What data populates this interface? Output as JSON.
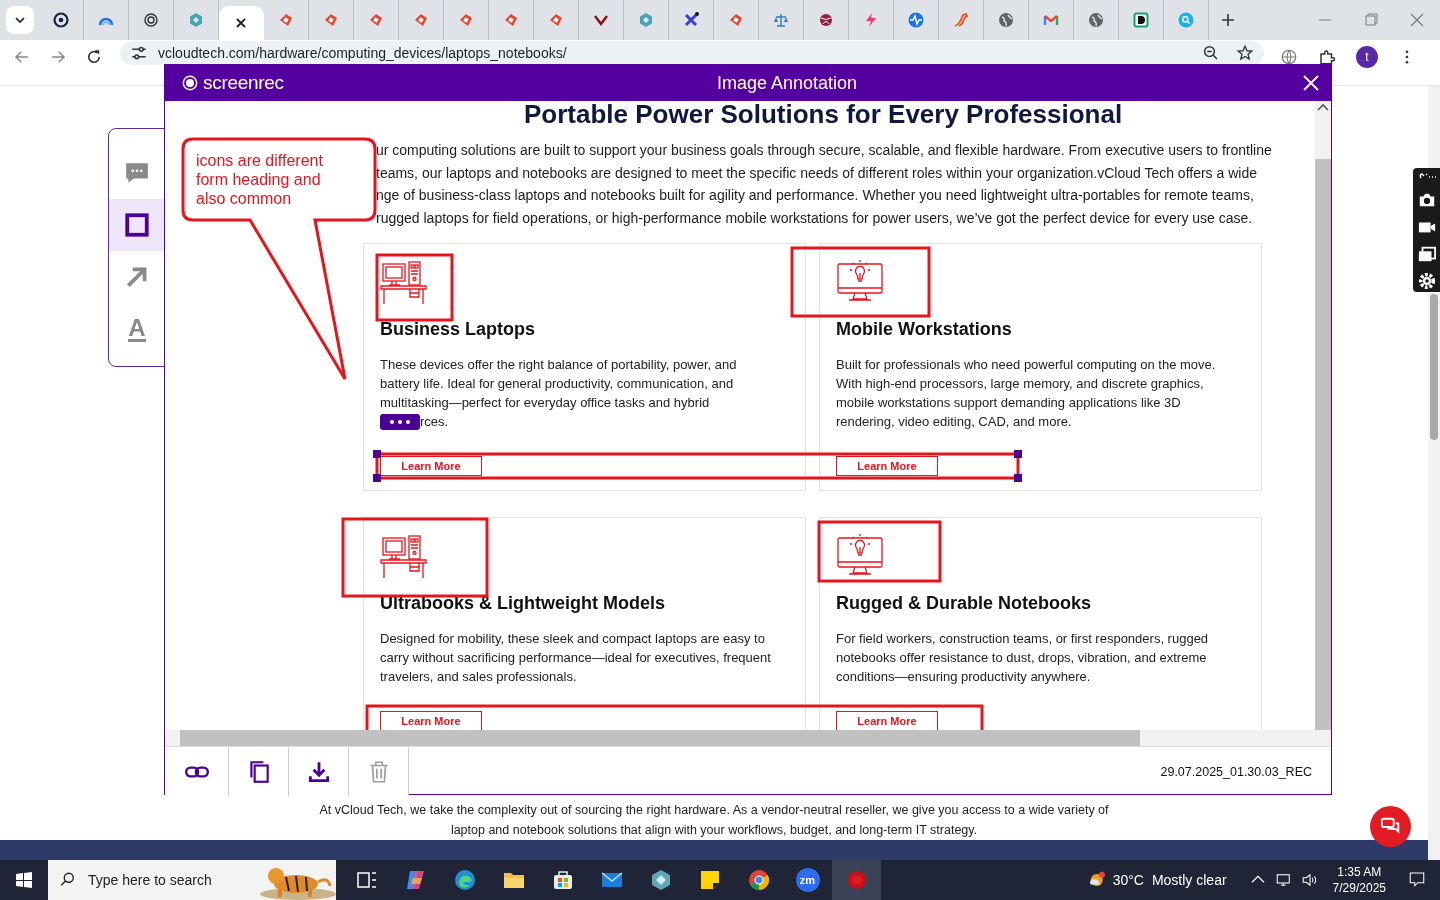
{
  "browser": {
    "tabs": [
      {
        "selected": false
      },
      {
        "selected": false
      },
      {
        "selected": false
      },
      {
        "selected": false
      },
      {
        "selected": true
      },
      {
        "selected": false
      },
      {
        "selected": false
      },
      {
        "selected": false
      },
      {
        "selected": false
      },
      {
        "selected": false
      },
      {
        "selected": false
      },
      {
        "selected": false
      },
      {
        "selected": false
      },
      {
        "selected": false
      },
      {
        "selected": false
      },
      {
        "selected": false
      },
      {
        "selected": false
      },
      {
        "selected": false
      },
      {
        "selected": false
      },
      {
        "selected": false
      },
      {
        "selected": false
      },
      {
        "selected": false
      },
      {
        "selected": false
      },
      {
        "selected": false
      },
      {
        "selected": false
      },
      {
        "selected": false
      }
    ],
    "url": "vcloudtech.com/hardware/computing_devices/laptops_notebooks/",
    "profile_initial": "t"
  },
  "annotation_tools": [
    {
      "kind": "comment",
      "selected": false
    },
    {
      "kind": "rectangle",
      "selected": true
    },
    {
      "kind": "arrow",
      "selected": false
    },
    {
      "kind": "text",
      "selected": false,
      "glyph": "A"
    }
  ],
  "modal": {
    "brand": "screen**rec**",
    "title": "Image Annotation",
    "heading": "Portable Power Solutions for Every Professional",
    "intro_lines": [
      "ur computing solutions are built to support your business goals through secure, scalable, and flexible hardware. From executive users to frontline",
      "teams, our laptops and notebooks are designed to meet the specific needs of different roles within your organization.vCloud Tech offers a wide",
      "nge of business-class laptops and notebooks built for agility and performance. Whether you need lightweight ultra-portables for remote teams,",
      "rugged laptops for field operations, or high-performance mobile workstations for power users, we’ve got the perfect device for every use case."
    ],
    "cards": [
      {
        "title": "Business Laptops",
        "body_lines": [
          "These devices offer the right balance of portability, power, and",
          "battery life. Ideal for general productivity, communication, and",
          "multitasking—perfect for everyday office tasks and hybrid",
          "rces."
        ],
        "menu_overlay": true,
        "button": "Learn More"
      },
      {
        "title": "Mobile Workstations",
        "body_lines": [
          "Built for professionals who need powerful computing on the move.",
          "With high-end processors, large memory, and discrete graphics,",
          "mobile workstations support demanding applications like 3D",
          "rendering, video editing, CAD, and more."
        ],
        "menu_overlay": false,
        "button": "Learn More"
      },
      {
        "title": "Ultrabooks & Lightweight Models",
        "body_lines": [
          "Designed for mobility, these sleek and compact laptops are easy to",
          "carry without sacrificing performance—ideal for executives, frequent",
          "travelers, and sales professionals."
        ],
        "menu_overlay": false,
        "button": "Learn More"
      },
      {
        "title": "Rugged & Durable Notebooks",
        "body_lines": [
          "For field workers, construction teams, or first responders, rugged",
          "notebooks offer resistance to dust, drops, vibration, and extreme",
          "conditions—ensuring productivity anywhere."
        ],
        "menu_overlay": false,
        "button": "Learn More"
      }
    ],
    "annotations": [
      {
        "kind": "rect",
        "selected": false
      },
      {
        "kind": "rect",
        "selected": false
      },
      {
        "kind": "rect",
        "selected": true
      },
      {
        "kind": "rect",
        "selected": false
      },
      {
        "kind": "rect",
        "selected": false
      },
      {
        "kind": "rect",
        "selected": false
      },
      {
        "kind": "callout",
        "selected": false,
        "text": "icons are different form heading and also common"
      }
    ],
    "filename": "29.07.2025_01.30.03_REC"
  },
  "page": {
    "bottom_lines": [
      "At vCloud Tech, we take the complexity out of sourcing the right hardware. As a vendor-neutral reseller, we give you access to a wide variety of",
      "laptop and notebook solutions that align with your workflows, budget, and long-term IT strategy."
    ]
  },
  "taskbar": {
    "search_placeholder": "Type here to search",
    "zoom_label": "zm",
    "temperature": "30°C",
    "weather": "Mostly clear",
    "time": "1:35 AM",
    "date": "7/29/2025"
  }
}
